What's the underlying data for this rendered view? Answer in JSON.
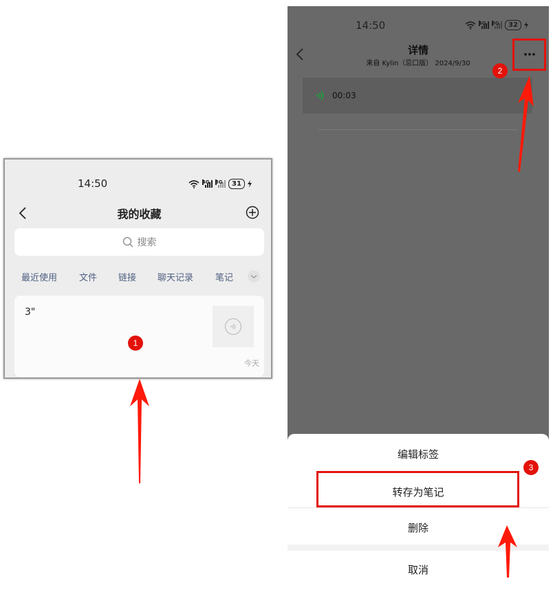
{
  "left_screen": {
    "status": {
      "time": "14:50",
      "signal_label": "4G",
      "signal2_label": "3G",
      "battery": "31"
    },
    "header": {
      "title": "我的收藏"
    },
    "search": {
      "placeholder": "搜索"
    },
    "tabs": [
      {
        "label": "最近使用"
      },
      {
        "label": "文件"
      },
      {
        "label": "链接"
      },
      {
        "label": "聊天记录"
      },
      {
        "label": "笔记"
      }
    ],
    "card": {
      "duration": "3\"",
      "date": "今天"
    }
  },
  "right_screen": {
    "status": {
      "time": "14:50",
      "signal_label": "4G",
      "signal2_label": "3G",
      "battery": "32"
    },
    "header": {
      "title": "详情",
      "subtitle": "来自 Kylin（忌口版） 2024/9/30"
    },
    "voice": {
      "duration": "00:03"
    },
    "sheet": {
      "items": [
        {
          "label": "编辑标签"
        },
        {
          "label": "转存为笔记"
        },
        {
          "label": "删除"
        },
        {
          "label": "取消"
        }
      ]
    }
  },
  "annotations": {
    "steps": [
      "1",
      "2",
      "3"
    ],
    "highlight_color": "#e3120b"
  },
  "icons": [
    "back-icon",
    "add-circle-icon",
    "search-icon",
    "chevron-down-icon",
    "voice-icon",
    "more-icon",
    "wifi-icon",
    "signal-icon",
    "battery-icon",
    "charging-icon"
  ]
}
